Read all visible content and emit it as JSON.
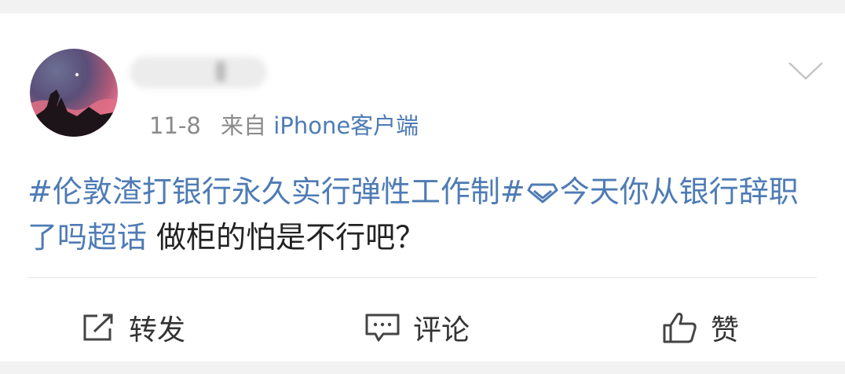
{
  "post": {
    "time": "11-8",
    "from_prefix": "来自",
    "device": "iPhone客户端",
    "topic": "#伦敦渣打银行永久实行弹性工作制#",
    "super_topic": "今天你从银行辞职了吗超话",
    "text": "做柜的怕是不行吧？"
  },
  "actions": {
    "repost": "转发",
    "comment": "评论",
    "like": "赞"
  },
  "icons": {
    "more": "chevron-down-icon",
    "super_topic": "diamond-icon",
    "repost": "share-square-icon",
    "comment": "comment-bubble-icon",
    "like": "thumbs-up-icon"
  },
  "colors": {
    "link": "#4e7bb5",
    "meta": "#8a8a8a",
    "text": "#222222",
    "background": "#f2f2f2",
    "card": "#ffffff"
  }
}
